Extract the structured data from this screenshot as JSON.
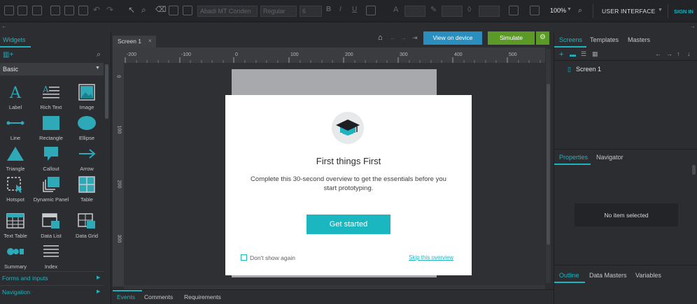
{
  "toolbar": {
    "font_name": "Abadi MT Conden",
    "font_style": "Regular",
    "font_size": "6",
    "zoom": "100%",
    "ui_mode": "USER INTERFACE",
    "signin": "SIGN IN"
  },
  "left_panel": {
    "tab": "Widgets",
    "library": "Basic",
    "widgets": [
      {
        "label": "Label",
        "icon": "label-icon"
      },
      {
        "label": "Rich Text",
        "icon": "rich-text-icon"
      },
      {
        "label": "Image",
        "icon": "image-icon"
      },
      {
        "label": "Line",
        "icon": "line-icon"
      },
      {
        "label": "Rectangle",
        "icon": "rectangle-icon"
      },
      {
        "label": "Ellipse",
        "icon": "ellipse-icon"
      },
      {
        "label": "Triangle",
        "icon": "triangle-icon"
      },
      {
        "label": "Callout",
        "icon": "callout-icon"
      },
      {
        "label": "Arrow",
        "icon": "arrow-icon"
      },
      {
        "label": "Hotspot",
        "icon": "hotspot-icon"
      },
      {
        "label": "Dynamic Panel",
        "icon": "dynamic-panel-icon"
      },
      {
        "label": "Table",
        "icon": "table-icon"
      },
      {
        "label": "Text Table",
        "icon": "text-table-icon"
      },
      {
        "label": "Data List",
        "icon": "data-list-icon"
      },
      {
        "label": "Data Grid",
        "icon": "data-grid-icon"
      },
      {
        "label": "Summary",
        "icon": "summary-icon"
      },
      {
        "label": "Index",
        "icon": "index-icon"
      }
    ],
    "sections": [
      "Forms and inputs",
      "Navigation"
    ]
  },
  "center": {
    "screen_tab": "Screen 1",
    "view_on_device": "View on device",
    "simulate": "Simulate",
    "ruler_top": [
      "-200",
      "-100",
      "0",
      "100",
      "200",
      "300",
      "400",
      "500"
    ],
    "ruler_left": [
      "0",
      "100",
      "200",
      "300"
    ],
    "bottom_tabs": [
      "Events",
      "Comments",
      "Requirements"
    ]
  },
  "right_panel": {
    "top_tabs": [
      "Screens",
      "Templates",
      "Masters"
    ],
    "screen_item": "Screen 1",
    "mid_tabs": [
      "Properties",
      "Navigator"
    ],
    "no_item": "No item selected",
    "bottom_tabs": [
      "Outline",
      "Data Masters",
      "Variables"
    ]
  },
  "modal": {
    "title": "First things First",
    "body": "Complete this 30-second overview to get the essentials before you start prototyping.",
    "primary": "Get started",
    "checkbox": "Don't show again",
    "skip": "Skip this overview"
  },
  "colors": {
    "accent": "#1fb3c0",
    "view_on_device": "#2a8fbf",
    "simulate": "#5c9a28",
    "primary_button": "#1ab7c0"
  }
}
